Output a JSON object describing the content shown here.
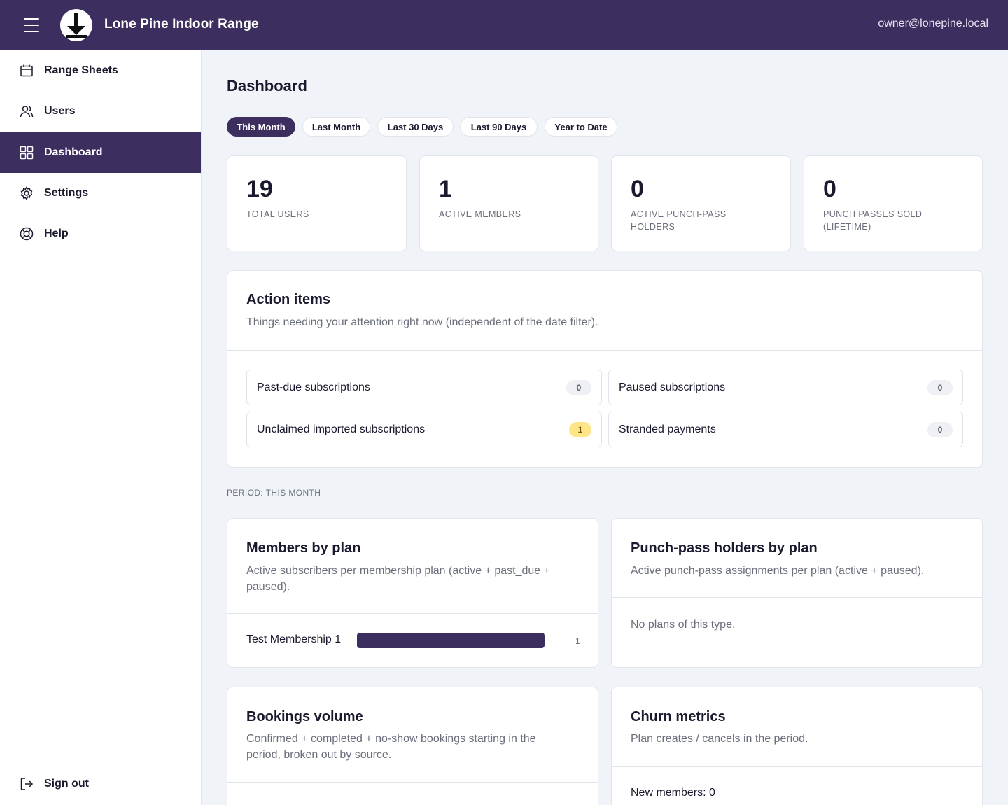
{
  "header": {
    "brand": "Lone Pine Indoor Range",
    "user_email": "owner@lonepine.local"
  },
  "sidebar": {
    "items": [
      {
        "label": "Range Sheets",
        "icon": "calendar-icon"
      },
      {
        "label": "Users",
        "icon": "users-icon"
      },
      {
        "label": "Dashboard",
        "icon": "grid-icon",
        "active": true
      },
      {
        "label": "Settings",
        "icon": "gear-icon"
      },
      {
        "label": "Help",
        "icon": "lifebuoy-icon"
      }
    ],
    "signout_label": "Sign out"
  },
  "page": {
    "title": "Dashboard",
    "filters": [
      "This Month",
      "Last Month",
      "Last 30 Days",
      "Last 90 Days",
      "Year to Date"
    ],
    "active_filter": "This Month"
  },
  "stats": [
    {
      "value": "19",
      "label": "TOTAL USERS"
    },
    {
      "value": "1",
      "label": "ACTIVE MEMBERS"
    },
    {
      "value": "0",
      "label": "ACTIVE PUNCH-PASS HOLDERS"
    },
    {
      "value": "0",
      "label": "PUNCH PASSES SOLD (LIFETIME)"
    }
  ],
  "action_items": {
    "title": "Action items",
    "description": "Things needing your attention right now (independent of the date filter).",
    "rows": [
      {
        "label": "Past-due subscriptions",
        "count": "0"
      },
      {
        "label": "Paused subscriptions",
        "count": "0"
      },
      {
        "label": "Unclaimed imported subscriptions",
        "count": "1"
      },
      {
        "label": "Stranded payments",
        "count": "0"
      }
    ]
  },
  "period_label": "PERIOD: THIS MONTH",
  "members_by_plan": {
    "title": "Members by plan",
    "description": "Active subscribers per membership plan (active + past_due + paused).",
    "rows": [
      {
        "plan": "Test Membership 1",
        "count": "1",
        "fraction": 1.0
      }
    ]
  },
  "punch_pass_holders": {
    "title": "Punch-pass holders by plan",
    "description": "Active punch-pass assignments per plan (active + paused).",
    "empty": "No plans of this type."
  },
  "bookings_volume": {
    "title": "Bookings volume",
    "description": "Confirmed + completed + no-show bookings starting in the period, broken out by source."
  },
  "churn": {
    "title": "Churn metrics",
    "description": "Plan creates / cancels in the period.",
    "new_members": "New members: 0"
  },
  "colors": {
    "brand": "#3c2f5f",
    "warn_badge": "#fde68a",
    "background": "#f0f3f8"
  }
}
